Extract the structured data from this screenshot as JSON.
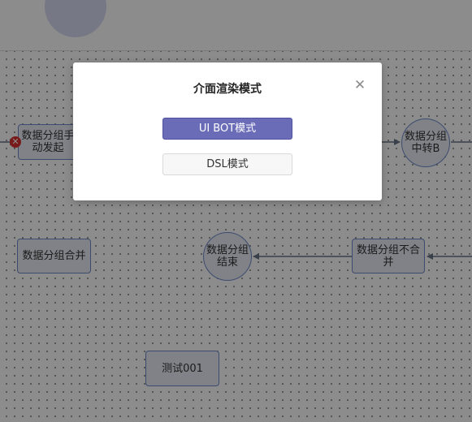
{
  "flow": {
    "nodes": [
      {
        "id": "data-group-manual",
        "label": "数据分组手动发起",
        "shape": "rect"
      },
      {
        "id": "data-group-merge",
        "label": "数据分组合并",
        "shape": "rect"
      },
      {
        "id": "data-group-end",
        "label": "数据分组结束",
        "shape": "circle"
      },
      {
        "id": "data-group-no-merge",
        "label": "数据分组不合并",
        "shape": "rect"
      },
      {
        "id": "data-group-transfer-b",
        "label": "数据分组中转B",
        "shape": "circle"
      },
      {
        "id": "test-001",
        "label": "测试001",
        "shape": "rect"
      }
    ],
    "node_fill": "#e9edf7",
    "node_border": "#6f8bc8",
    "edge_color": "#6b7585",
    "error_badge_color": "#d9302f",
    "error_icon": "x-icon"
  },
  "modal": {
    "title": "介面渲染模式",
    "close_icon": "close-icon",
    "primary_label": "UI BOT模式",
    "secondary_label": "DSL模式",
    "primary_color": "#6a6cb8"
  }
}
